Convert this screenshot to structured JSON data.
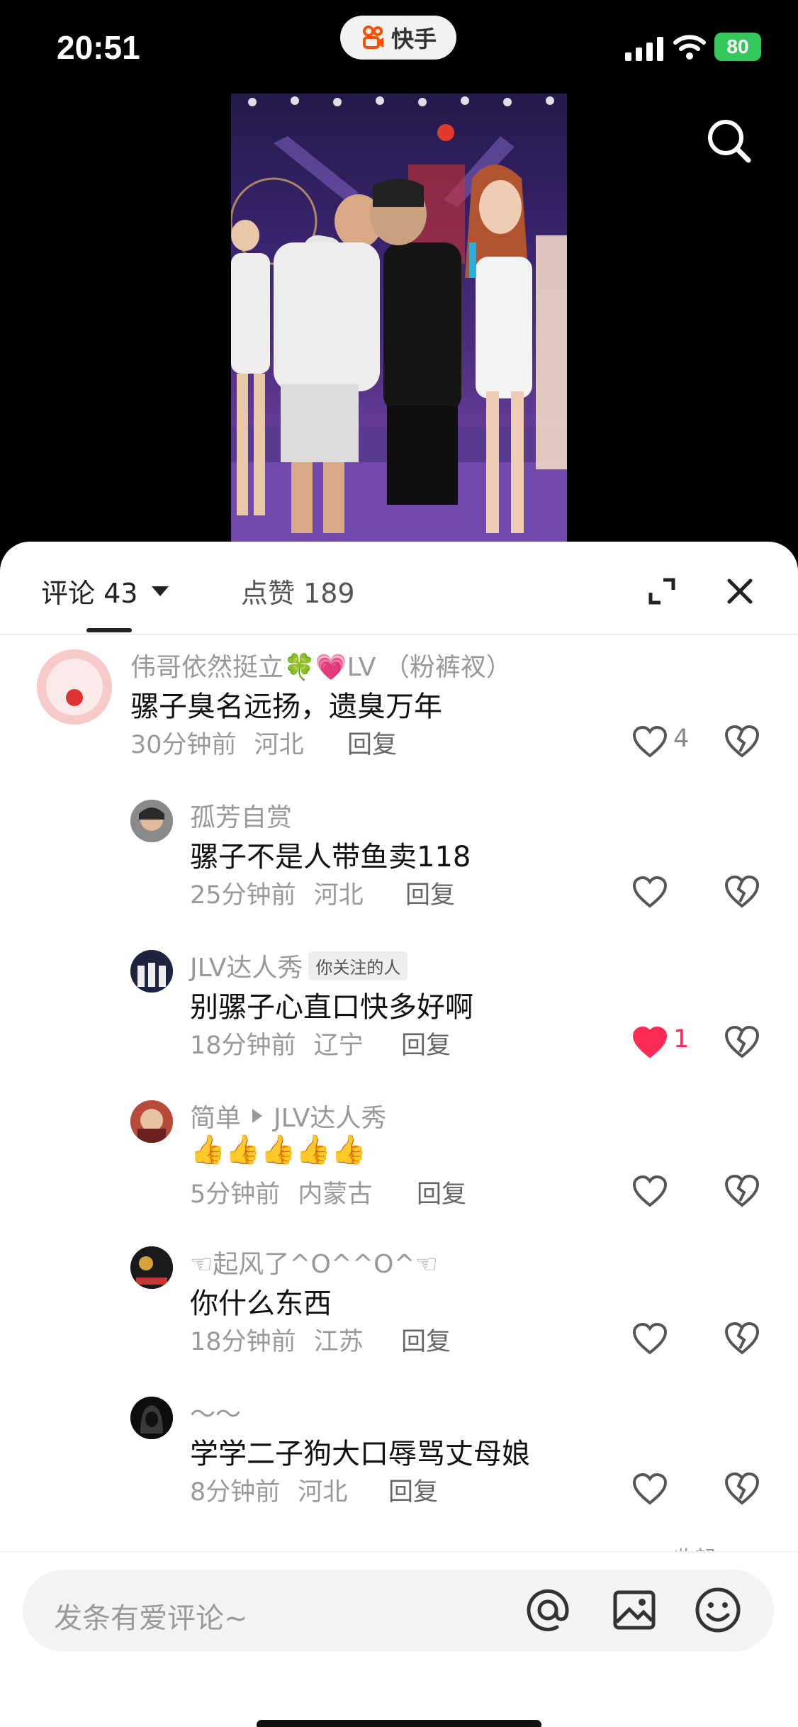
{
  "status_bar": {
    "time": "20:51",
    "app_name": "快手",
    "battery": "80"
  },
  "tabs": {
    "comments_label": "评论 43",
    "likes_label": "点赞 189"
  },
  "comments": [
    {
      "user": "伟哥依然挺立🍀💗LV （粉裤衩）",
      "text": "骡子臭名远扬，遗臭万年",
      "time": "30分钟前",
      "location": "河北",
      "reply": "回复",
      "likes": "4",
      "liked": false
    },
    {
      "user": "孤芳自赏",
      "text": "骡子不是人带鱼卖118",
      "time": "25分钟前",
      "location": "河北",
      "reply": "回复",
      "likes": "",
      "liked": false
    },
    {
      "user": "JLV达人秀",
      "badge": "你关注的人",
      "text": "别骡子心直口快多好啊",
      "time": "18分钟前",
      "location": "辽宁",
      "reply": "回复",
      "likes": "1",
      "liked": true
    },
    {
      "user": "简单",
      "reply_to": "JLV达人秀",
      "text": "👍👍👍👍👍",
      "time": "5分钟前",
      "location": "内蒙古",
      "reply": "回复",
      "likes": "",
      "liked": false
    },
    {
      "user": "☜起风了^O^^O^☜",
      "text": "你什么东西",
      "time": "18分钟前",
      "location": "江苏",
      "reply": "回复",
      "likes": "",
      "liked": false
    },
    {
      "user": "～～",
      "text": "学学二子狗大口辱骂丈母娘",
      "time": "8分钟前",
      "location": "河北",
      "reply": "回复",
      "likes": "",
      "liked": false
    }
  ],
  "collapse_hint": "收起",
  "input": {
    "placeholder": "发条有爱评论~"
  },
  "colors": {
    "accent_like": "#fe2c55",
    "battery": "#34c759",
    "brand": "#ff5000"
  }
}
